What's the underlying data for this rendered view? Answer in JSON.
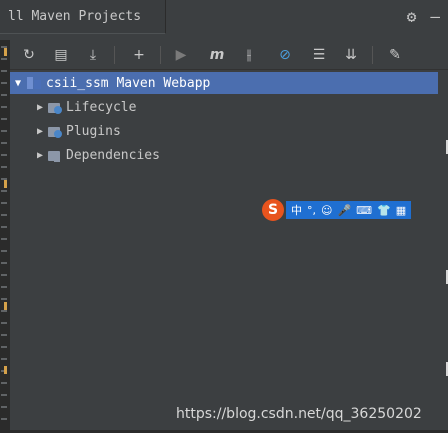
{
  "window": {
    "title": "ll Maven Projects",
    "settings_icon": "gear-icon",
    "minimize_icon": "minimize-icon"
  },
  "toolbar": {
    "buttons": [
      {
        "name": "reimport-all",
        "icon": "refresh-icon",
        "glyph": "↻"
      },
      {
        "name": "generate-sources",
        "icon": "folder-gear-icon",
        "glyph": "▤"
      },
      {
        "name": "download",
        "icon": "download-icon",
        "glyph": "⤓"
      },
      {
        "name": "add",
        "icon": "plus-icon",
        "glyph": "+"
      },
      {
        "name": "run",
        "icon": "run-icon",
        "glyph": "▶"
      },
      {
        "name": "execute-goal",
        "icon": "maven-goal-icon",
        "glyph": "m"
      },
      {
        "name": "toggle-offline",
        "icon": "offline-icon",
        "glyph": "⫲"
      },
      {
        "name": "skip-tests",
        "icon": "skip-tests-icon",
        "glyph": "⊘"
      },
      {
        "name": "show-dependencies",
        "icon": "diagram-icon",
        "glyph": "☰"
      },
      {
        "name": "collapse-all",
        "icon": "collapse-icon",
        "glyph": "⇊"
      },
      {
        "name": "maven-settings",
        "icon": "wrench-icon",
        "glyph": "✎"
      }
    ]
  },
  "tree": {
    "root": "csii_ssm Maven Webapp",
    "children": [
      {
        "label": "Lifecycle",
        "expanded": false
      },
      {
        "label": "Plugins",
        "expanded": false
      },
      {
        "label": "Dependencies",
        "expanded": false
      }
    ]
  },
  "ime_toolbar": {
    "logo": "S",
    "items": [
      "中",
      "°,",
      "☺",
      "🎤",
      "⌨",
      "👕",
      "▦"
    ]
  },
  "watermark": "https://blog.csdn.net/qq_36250202",
  "colors": {
    "background": "#3c3f41",
    "selection": "#4b6eaf",
    "text": "#c8c8c8",
    "ime_orange": "#e8541e",
    "ime_blue": "#1f6fd1"
  }
}
